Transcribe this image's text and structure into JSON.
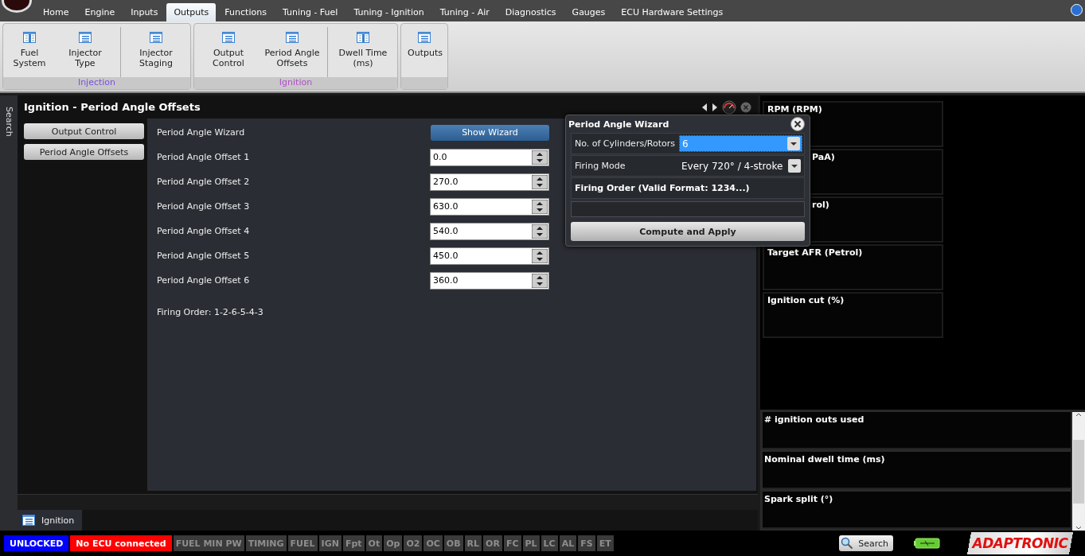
{
  "menu_tabs": [
    {
      "label": "Home",
      "selected": false
    },
    {
      "label": "Engine",
      "selected": false
    },
    {
      "label": "Inputs",
      "selected": false
    },
    {
      "label": "Outputs",
      "selected": true
    },
    {
      "label": "Functions",
      "selected": false
    },
    {
      "label": "Tuning - Fuel",
      "selected": false
    },
    {
      "label": "Tuning - Ignition",
      "selected": false
    },
    {
      "label": "Tuning - Air",
      "selected": false
    },
    {
      "label": "Diagnostics",
      "selected": false
    },
    {
      "label": "Gauges",
      "selected": false
    },
    {
      "label": "ECU Hardware Settings",
      "selected": false
    }
  ],
  "ribbon_groups": [
    {
      "title": "Injection",
      "color": "#7b4fe0",
      "buttons": [
        {
          "label": "Fuel System",
          "kind": "grid"
        },
        {
          "label": "Injector Type",
          "kind": "list"
        },
        {
          "label": "Injector Staging",
          "kind": "list",
          "separated": true
        }
      ]
    },
    {
      "title": "Ignition",
      "color": "#b050c8",
      "buttons": [
        {
          "label": "Output Control",
          "kind": "list"
        },
        {
          "label": "Period Angle Offsets",
          "kind": "list"
        },
        {
          "label": "Dwell Time (ms)",
          "kind": "grid",
          "separated": true
        }
      ]
    },
    {
      "buttons": [
        {
          "label": "Outputs",
          "kind": "list"
        }
      ]
    }
  ],
  "side_tab": "Search",
  "panel": {
    "title": "Ignition - Period Angle Offsets",
    "nav": [
      {
        "label": "Output Control"
      },
      {
        "label": "Period Angle Offsets"
      }
    ],
    "wizard_row": {
      "label": "Period Angle Wizard",
      "button": "Show Wizard"
    },
    "offsets": [
      {
        "label": "Period Angle Offset 1",
        "value": "0.0"
      },
      {
        "label": "Period Angle Offset 2",
        "value": "270.0"
      },
      {
        "label": "Period Angle Offset 3",
        "value": "630.0"
      },
      {
        "label": "Period Angle Offset 4",
        "value": "540.0"
      },
      {
        "label": "Period Angle Offset 5",
        "value": "450.0"
      },
      {
        "label": "Period Angle Offset 6",
        "value": "360.0"
      }
    ],
    "firing_order": "Firing Order: 1-2-6-5-4-3"
  },
  "bottom_tab": "Ignition",
  "dialog": {
    "title": "Period Angle Wizard",
    "cylinders": {
      "label": "No. of Cylinders/Rotors",
      "value": "6"
    },
    "firing_mode": {
      "label": "Firing Mode",
      "value": "Every 720° / 4-stroke"
    },
    "firing_order_label": "Firing Order (Valid Format: 1234...)",
    "apply": "Compute and Apply"
  },
  "gauges_top": [
    {
      "label": "RPM (RPM)",
      "covered": false
    },
    {
      "label": "PaA)",
      "covered": true
    },
    {
      "label": "rol)",
      "covered": true
    },
    {
      "label": "Target AFR (Petrol)",
      "covered": false
    },
    {
      "label": "Ignition cut (%)",
      "covered": false
    }
  ],
  "gauges_bottom": [
    {
      "label": "# ignition outs used"
    },
    {
      "label": "Nominal dwell time (ms)"
    },
    {
      "label": "Spark split (°)"
    }
  ],
  "status": [
    {
      "label": "UNLOCKED",
      "color": "#0000ff"
    },
    {
      "label": "No ECU connected",
      "color": "#ff0000"
    },
    {
      "label": "FUEL MIN PW"
    },
    {
      "label": "TIMING"
    },
    {
      "label": "FUEL"
    },
    {
      "label": "IGN"
    },
    {
      "label": "Fpt"
    },
    {
      "label": "Ot"
    },
    {
      "label": "Op"
    },
    {
      "label": "O2"
    },
    {
      "label": "OC"
    },
    {
      "label": "OB"
    },
    {
      "label": "RL"
    },
    {
      "label": "OR"
    },
    {
      "label": "FC"
    },
    {
      "label": "PL"
    },
    {
      "label": "LC"
    },
    {
      "label": "AL"
    },
    {
      "label": "FS"
    },
    {
      "label": "ET"
    }
  ],
  "search_button": "Search",
  "logo": "ADAPTRONIC"
}
